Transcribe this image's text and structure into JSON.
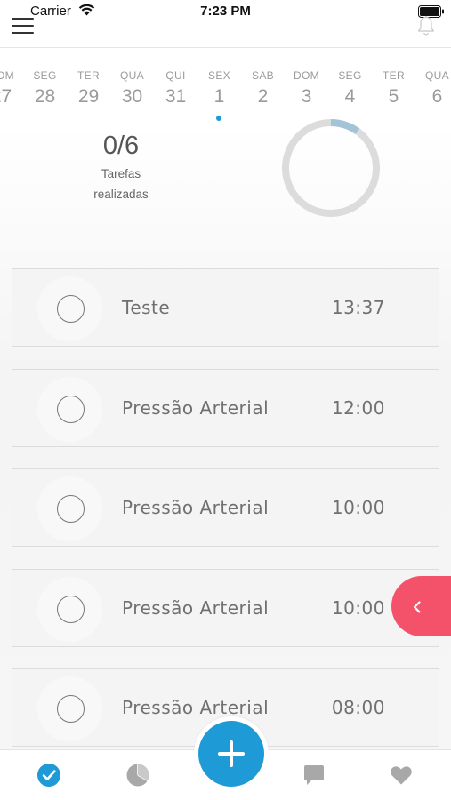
{
  "status_bar": {
    "carrier": "Carrier",
    "time": "7:23 PM",
    "wifi_icon": "wifi-icon",
    "battery_icon": "battery-full-icon"
  },
  "nav": {
    "menu_icon": "hamburger-menu-icon",
    "notifications_icon": "bell-icon"
  },
  "week": [
    {
      "name": "DOM",
      "num": "27"
    },
    {
      "name": "SEG",
      "num": "28"
    },
    {
      "name": "TER",
      "num": "29"
    },
    {
      "name": "QUA",
      "num": "30"
    },
    {
      "name": "QUI",
      "num": "31"
    },
    {
      "name": "SEX",
      "num": "1",
      "selected": true
    },
    {
      "name": "SAB",
      "num": "2"
    },
    {
      "name": "DOM",
      "num": "3"
    },
    {
      "name": "SEG",
      "num": "4"
    },
    {
      "name": "TER",
      "num": "5"
    },
    {
      "name": "QUA",
      "num": "6"
    }
  ],
  "summary": {
    "count": "0/6",
    "label_line1": "Tarefas",
    "label_line2": "realizadas",
    "progress_fraction": 0.1,
    "ring_track_color": "#dcdcdc",
    "ring_progress_color": "#a3c3d6"
  },
  "tasks": [
    {
      "title": "Teste",
      "time": "13:37",
      "done": false
    },
    {
      "title": "Pressão Arterial",
      "time": "12:00",
      "done": false
    },
    {
      "title": "Pressão Arterial",
      "time": "10:00",
      "done": false
    },
    {
      "title": "Pressão Arterial",
      "time": "10:00",
      "done": false
    },
    {
      "title": "Pressão Arterial",
      "time": "08:00",
      "done": false
    }
  ],
  "side_tab": {
    "icon": "chevron-left-icon",
    "color": "#f4526b"
  },
  "tab_bar": {
    "tabs": [
      {
        "icon": "check-circle-icon",
        "active": true
      },
      {
        "icon": "pie-chart-icon",
        "active": false
      },
      {
        "icon": "chat-bubble-icon",
        "active": false
      },
      {
        "icon": "heart-icon",
        "active": false
      }
    ],
    "fab_icon": "plus-icon",
    "accent_color": "#1e9ad6",
    "inactive_color": "#a8a8a8"
  }
}
